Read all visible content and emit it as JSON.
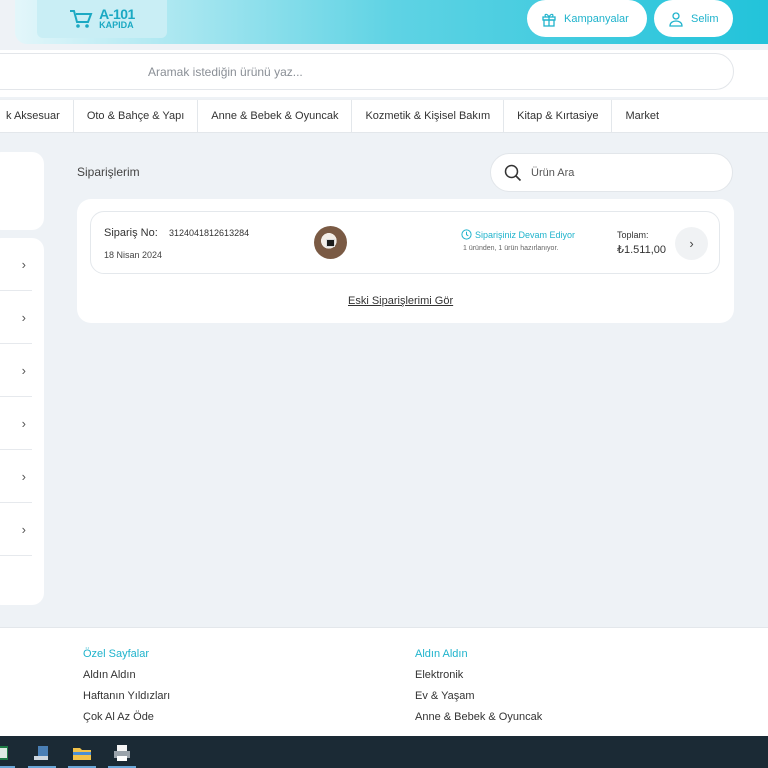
{
  "header": {
    "logo_text_top": "A-101",
    "logo_text_bottom": "KAPIDA",
    "campaigns_label": "Kampanyalar",
    "user_label": "Selim"
  },
  "search": {
    "placeholder": "Aramak istediğin ürünü yaz..."
  },
  "categories": [
    "k Aksesuar",
    "Oto & Bahçe & Yapı",
    "Anne & Bebek & Oyuncak",
    "Kozmetik & Kişisel Bakım",
    "Kitap & Kırtasiye",
    "Market"
  ],
  "sidebar": {
    "chevron": "›"
  },
  "main": {
    "title": "Siparişlerim",
    "product_search_placeholder": "Ürün Ara",
    "order": {
      "label": "Sipariş No:",
      "number": "3124041812613284",
      "date": "18 Nisan 2024",
      "status": "Siparişiniz Devam Ediyor",
      "status_sub": "1 üründen, 1 ürün hazırlanıyor.",
      "total_label": "Toplam:",
      "total": "₺1.511,00"
    },
    "old_orders_link": "Eski Siparişlerimi Gör"
  },
  "footer": {
    "col1": {
      "heading": "Özel Sayfalar",
      "links": [
        "Aldın Aldın",
        "Haftanın Yıldızları",
        "Çok Al Az Öde"
      ]
    },
    "col2": {
      "heading": "Aldın Aldın",
      "links": [
        "Elektronik",
        "Ev & Yaşam",
        "Anne & Bebek & Oyuncak"
      ]
    }
  },
  "colors": {
    "accent": "#1fb3cc",
    "background": "#eef2f6",
    "taskbar": "#1b2a35"
  }
}
